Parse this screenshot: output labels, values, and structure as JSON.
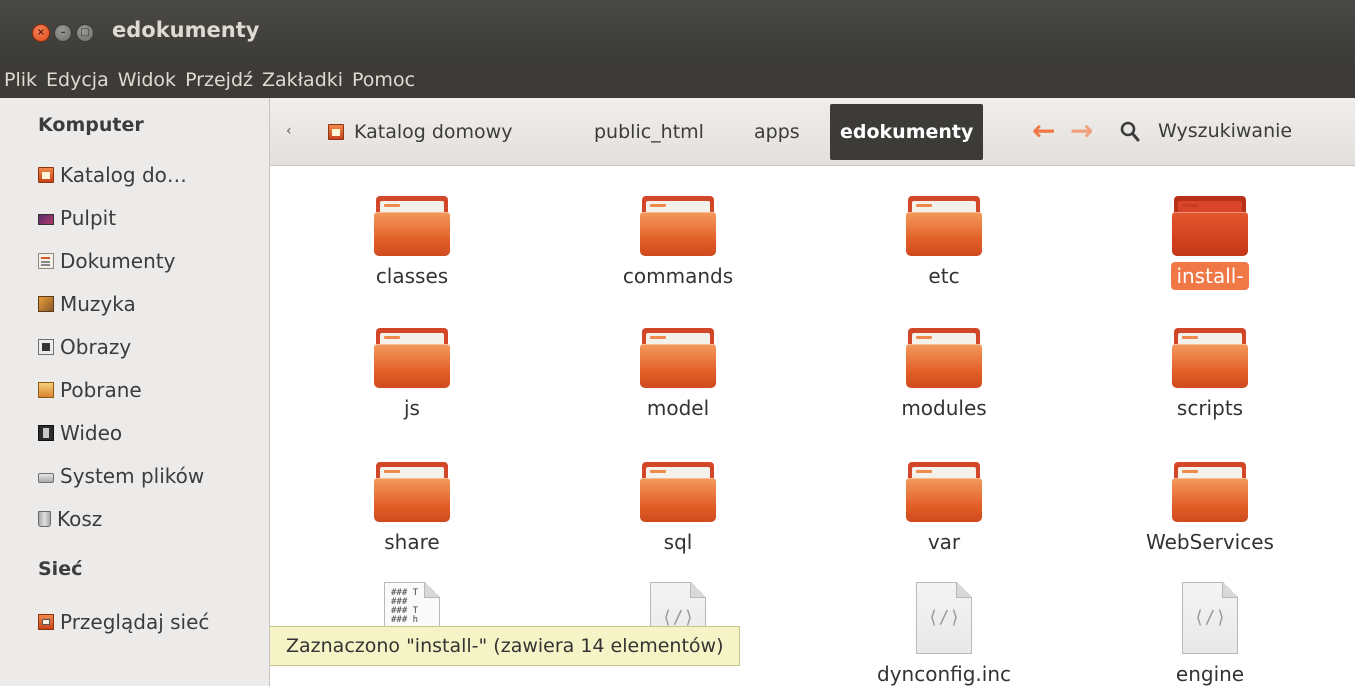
{
  "window": {
    "title": "edokumenty"
  },
  "menu": [
    "Plik",
    "Edycja",
    "Widok",
    "Przejdź",
    "Zakładki",
    "Pomoc"
  ],
  "sidebar": {
    "computer_header": "Komputer",
    "items": [
      {
        "label": "Katalog do…",
        "icon": "home-folder-icon"
      },
      {
        "label": "Pulpit",
        "icon": "desktop-icon"
      },
      {
        "label": "Dokumenty",
        "icon": "documents-icon"
      },
      {
        "label": "Muzyka",
        "icon": "music-icon"
      },
      {
        "label": "Obrazy",
        "icon": "pictures-icon"
      },
      {
        "label": "Pobrane",
        "icon": "downloads-icon"
      },
      {
        "label": "Wideo",
        "icon": "video-icon"
      },
      {
        "label": "System plików",
        "icon": "filesystem-icon"
      },
      {
        "label": "Kosz",
        "icon": "trash-icon"
      }
    ],
    "network_header": "Sieć",
    "network_items": [
      {
        "label": "Przeglądaj sieć",
        "icon": "network-icon"
      }
    ]
  },
  "pathbar": {
    "left_arrow": "‹",
    "crumbs": [
      "Katalog domowy",
      "public_html",
      "apps",
      "edokumenty"
    ],
    "active": "edokumenty",
    "back_arrow": "←",
    "forward_arrow": "→",
    "search_label": "Wyszukiwanie"
  },
  "items": [
    {
      "name": "classes",
      "type": "folder"
    },
    {
      "name": "commands",
      "type": "folder"
    },
    {
      "name": "etc",
      "type": "folder"
    },
    {
      "name": "install-",
      "type": "folder",
      "selected": true
    },
    {
      "name": "js",
      "type": "folder"
    },
    {
      "name": "model",
      "type": "folder"
    },
    {
      "name": "modules",
      "type": "folder"
    },
    {
      "name": "scripts",
      "type": "folder"
    },
    {
      "name": "share",
      "type": "folder"
    },
    {
      "name": "sql",
      "type": "folder"
    },
    {
      "name": "var",
      "type": "folder"
    },
    {
      "name": "WebServices",
      "type": "folder"
    },
    {
      "name": "",
      "type": "text-file",
      "preview": "### T\n###\n### T\n### h"
    },
    {
      "name": "",
      "type": "code-file"
    },
    {
      "name": "dynconfig.inc",
      "type": "code-file"
    },
    {
      "name": "engine",
      "type": "code-file"
    }
  ],
  "code_glyph": "⟨/⟩",
  "status": "Zaznaczono \"install-\" (zawiera 14 elementów)",
  "colors": {
    "accent": "#f07746",
    "titlebar": "#3c3b37",
    "sidebar": "#edebe9",
    "tooltip": "#f5f4c6"
  }
}
